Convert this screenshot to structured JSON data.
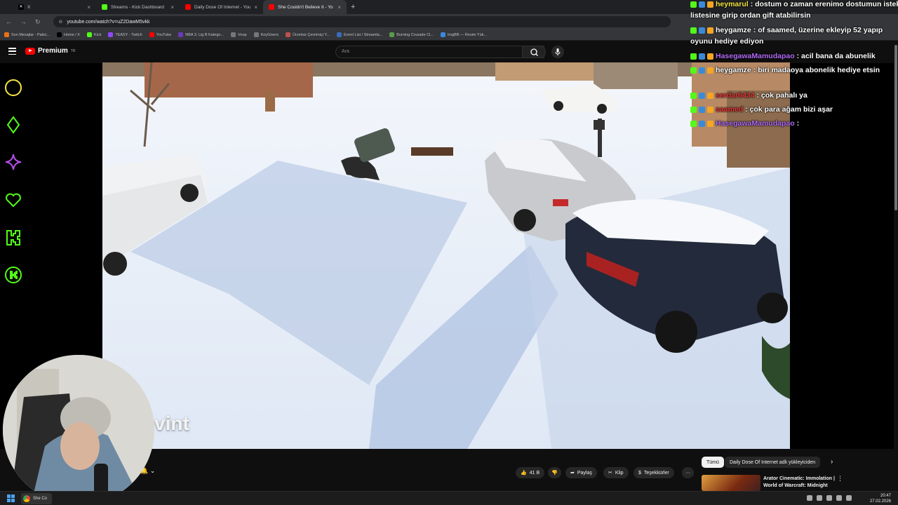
{
  "browser": {
    "tabs": [
      {
        "label": "X",
        "color": "#000000"
      },
      {
        "label": "Streams - Kick Dashboard",
        "color": "#53fc18"
      },
      {
        "label": "Daily Dose Of Internet - YouTube",
        "color": "#ff0000"
      },
      {
        "label": "She Couldn't Believe It - Yo",
        "color": "#ff0000"
      }
    ],
    "new_tab": "+",
    "url": "youtube.com/watch?v=uZ2DawM5vkk",
    "bookmarks": [
      {
        "label": "Son Mesajlar - Patici...",
        "color": "#e8711a"
      },
      {
        "label": "Home / X",
        "color": "#000000"
      },
      {
        "label": "Kick",
        "color": "#53fc18"
      },
      {
        "label": "TEASY - Twitch",
        "color": "#9146ff"
      },
      {
        "label": "YouTube",
        "color": "#ff0000"
      },
      {
        "label": "NBA 3. Lig B Katego...",
        "color": "#6a3ab8"
      },
      {
        "label": "Voop",
        "color": "#777777"
      },
      {
        "label": "KeyGivers",
        "color": "#777777"
      },
      {
        "label": "Ücretsiz Çevrimiçi Y...",
        "color": "#c0504d"
      },
      {
        "label": "Event List / Streamla...",
        "color": "#3a6ab8"
      },
      {
        "label": "Burning Crusade Cl...",
        "color": "#5a9a4a"
      },
      {
        "label": "ImgBB — Resim Yük...",
        "color": "#3a8ad8"
      }
    ]
  },
  "youtube": {
    "logo": "Premium",
    "logo_sup": "TR",
    "search_placeholder": "Ara",
    "caption": "vint",
    "actions": {
      "like_count": "41 B",
      "share": "Paylaş",
      "clip": "Klip",
      "thanks": "Teşekkürler",
      "more": "···"
    },
    "chips": {
      "all": "Tümü",
      "channel": "Daily Dose Of Internet adlı yükleyiciden"
    },
    "recommendation": {
      "title": "Arator Cinematic: Immolation | World of Warcraft: Midnight"
    }
  },
  "chat": {
    "messages": [
      {
        "user": "heymarul",
        "text": ": dostum o zaman erenimo dostumun istek",
        "user_color": "#f5e642"
      },
      {
        "user": "",
        "text": "listesine girip ordan gift atabilirsin",
        "user_color": "#ffffff"
      },
      {
        "user": "heygamze",
        "text": ": of saamed, üzerine ekleyip 52 yapıp",
        "user_color": "#ffffff"
      },
      {
        "user": "",
        "text": "oyunu hediye ediyon",
        "user_color": "#ffffff"
      },
      {
        "user": "HasegawaMamudapao",
        "text": ": acil bana da abunelik",
        "user_color": "#b06af5"
      },
      {
        "user": "heygamze",
        "text": ": biri madaoya abonelik hediye etsin",
        "user_color": "#ffffff"
      },
      {
        "user": "serdar6434",
        "text": ": çok pahalı ya",
        "user_color": "#e83a3a"
      },
      {
        "user": "saamed",
        "text": ": çok para ağam bizi aşar",
        "user_color": "#e83a3a"
      },
      {
        "user": "HasegawaMamudapao",
        "text": ":",
        "user_color": "#b06af5"
      }
    ]
  },
  "taskbar": {
    "app_label": "She Co",
    "time": "20:47",
    "date": "27.02.2026"
  },
  "colors": {
    "kick_green": "#53fc18",
    "shape_yellow": "#f5e642",
    "shape_purple": "#b44fe8",
    "youtube_red": "#ff0000"
  }
}
